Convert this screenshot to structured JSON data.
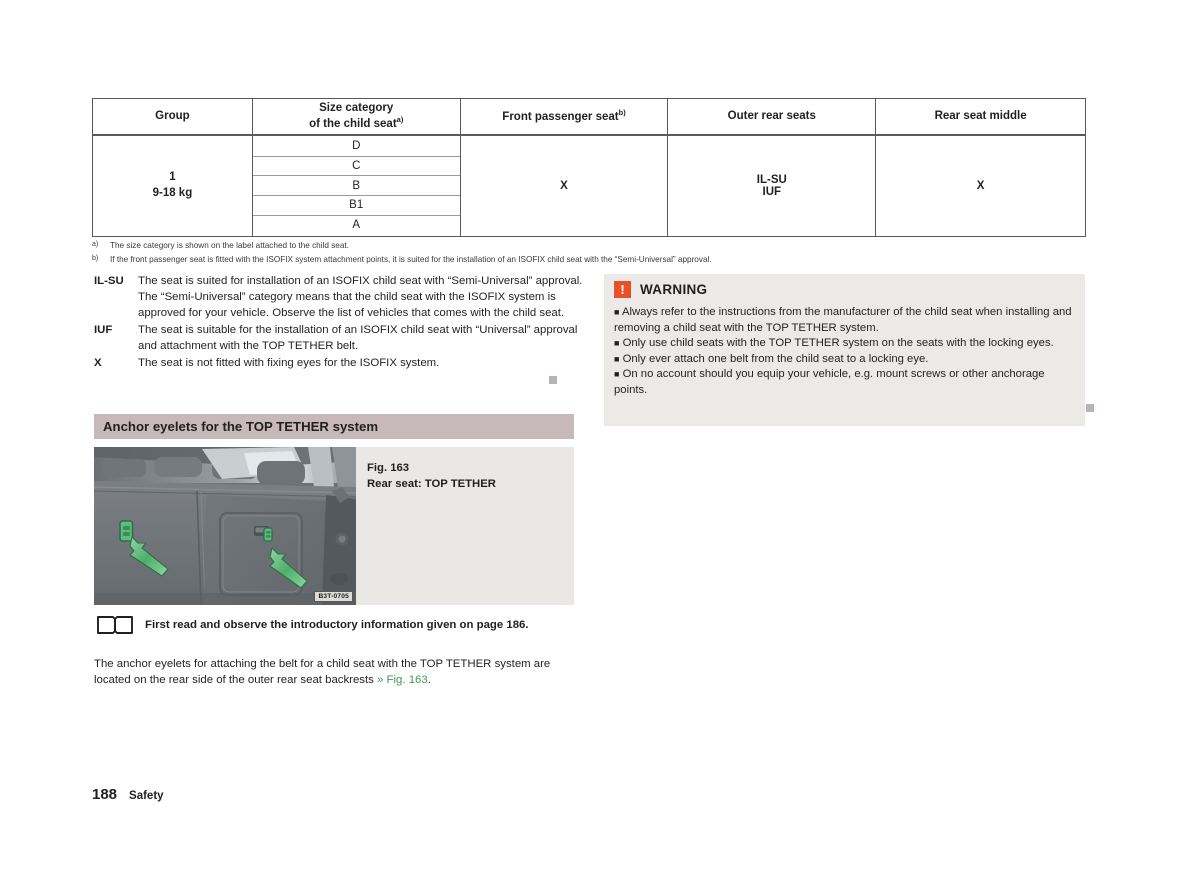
{
  "table": {
    "headers": [
      {
        "label": "Group",
        "footnote": ""
      },
      {
        "label": "Size category",
        "label2": "of the child seat",
        "footnote": "a)"
      },
      {
        "label": "Front passenger seat",
        "footnote": "b)"
      },
      {
        "label": "Outer rear seats",
        "footnote": ""
      },
      {
        "label": "Rear seat middle",
        "footnote": ""
      }
    ],
    "rows": [
      {
        "group_line1": "1",
        "group_line2": "9-18 kg",
        "size_categories": [
          "D",
          "C",
          "B",
          "B1",
          "A"
        ],
        "front_passenger": "X",
        "outer_rear_line1": "IL-SU",
        "outer_rear_line2": "IUF",
        "rear_middle": "X"
      }
    ]
  },
  "footnotes": [
    {
      "mark": "a)",
      "text": "The size category is shown on the label attached to the child seat."
    },
    {
      "mark": "b)",
      "text": "If the front passenger seat is fitted with the ISOFIX system attachment points, it is suited for the installation of an ISOFIX child seat with the “Semi-Universal” approval."
    }
  ],
  "legend": [
    {
      "key": "IL-SU",
      "text": "The seat is suited for installation of an ISOFIX child seat with “Semi-Universal” approval. The “Semi-Universal” category means that the child seat with the ISOFIX system is approved for your vehicle. Observe the list of vehicles that comes with the child seat."
    },
    {
      "key": "IUF",
      "text": "The seat is suitable for the installation of an ISOFIX child seat with “Universal” approval and attachment with the TOP TETHER belt."
    },
    {
      "key": "X",
      "text": "The seat is not fitted with fixing eyes for the ISOFIX system."
    }
  ],
  "warning": {
    "icon": "exclamation-icon",
    "icon_glyph": "!",
    "title": "WARNING",
    "icon_color": "#e8502a",
    "background": "#ebeae6",
    "bullets": [
      "Always refer to the instructions from the manufacturer of the child seat when installing and removing a child seat with the TOP TETHER system.",
      "Only use child seats with the TOP TETHER system on the seats with the locking eyes.",
      "Only ever attach one belt from the child seat to a locking eye.",
      "On no account should you equip your vehicle, e.g. mount screws or other anchorage points."
    ]
  },
  "section": {
    "heading": "Anchor eyelets for the TOP TETHER system",
    "heading_background": "#c7b9b9"
  },
  "figure": {
    "image_name": "rear-seat-top-tether-photo",
    "image_code": "B3T-0705",
    "caption_number": "Fig. 163",
    "caption_title": "Rear seat: TOP TETHER",
    "background": "#e9e8e4",
    "highlight_color": "#6cc48a"
  },
  "read_note": {
    "icon": "book-icon",
    "text": "First read and observe the introductory information given on page 186."
  },
  "body_paragraph": {
    "text_before": "The anchor eyelets for attaching the belt for a child seat with the TOP TETHER system are located on the rear side of the outer rear seat backrests ",
    "xref_chevron": "»",
    "xref_label": "Fig. 163",
    "text_after": ".",
    "xref_color": "#3f9a52"
  },
  "footer": {
    "page_number": "188",
    "chapter": "Safety"
  }
}
